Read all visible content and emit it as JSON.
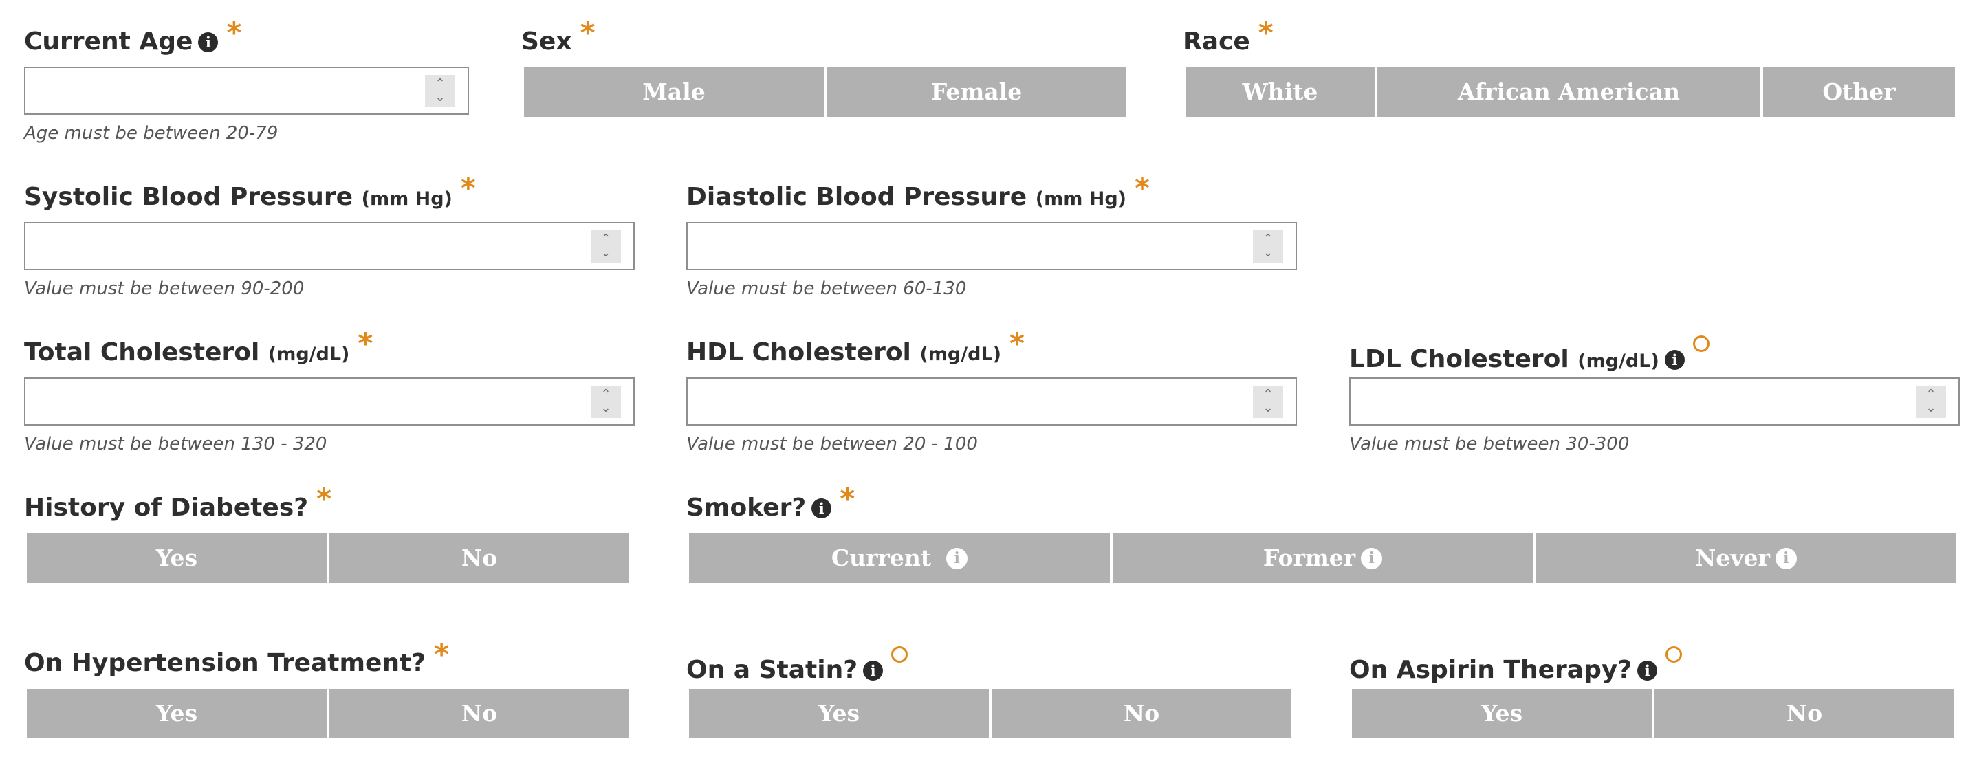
{
  "age": {
    "label": "Current Age",
    "hint": "Age must be between 20-79"
  },
  "sex": {
    "label": "Sex",
    "options": [
      "Male",
      "Female"
    ]
  },
  "race": {
    "label": "Race",
    "options": [
      "White",
      "African American",
      "Other"
    ]
  },
  "systolic": {
    "label": "Systolic Blood Pressure",
    "unit": "(mm Hg)",
    "hint": "Value must be between 90-200"
  },
  "diastolic": {
    "label": "Diastolic Blood Pressure",
    "unit": "(mm Hg)",
    "hint": "Value must be between 60-130"
  },
  "total_chol": {
    "label": "Total Cholesterol",
    "unit": "(mg/dL)",
    "hint": "Value must be between 130 - 320"
  },
  "hdl_chol": {
    "label": "HDL Cholesterol",
    "unit": "(mg/dL)",
    "hint": "Value must be between 20 - 100"
  },
  "ldl_chol": {
    "label": "LDL Cholesterol",
    "unit": "(mg/dL)",
    "hint": "Value must be between 30-300"
  },
  "diabetes": {
    "label": "History of Diabetes?",
    "options": [
      "Yes",
      "No"
    ]
  },
  "smoker": {
    "label": "Smoker?",
    "options": [
      "Current",
      "Former",
      "Never"
    ]
  },
  "hypertension": {
    "label": "On Hypertension Treatment?",
    "options": [
      "Yes",
      "No"
    ]
  },
  "statin": {
    "label": "On a Statin?",
    "options": [
      "Yes",
      "No"
    ]
  },
  "aspirin": {
    "label": "On Aspirin Therapy?",
    "options": [
      "Yes",
      "No"
    ]
  },
  "icons": {
    "info": "info-circle-icon",
    "required": "required-asterisk-icon",
    "optional": "optional-circle-icon",
    "spinner": "number-spinner-icon"
  },
  "colors": {
    "accent": "#e08a1c",
    "button_bg": "#b1b1b1",
    "label_text": "#2e2e2e",
    "hint_text": "#555555"
  }
}
